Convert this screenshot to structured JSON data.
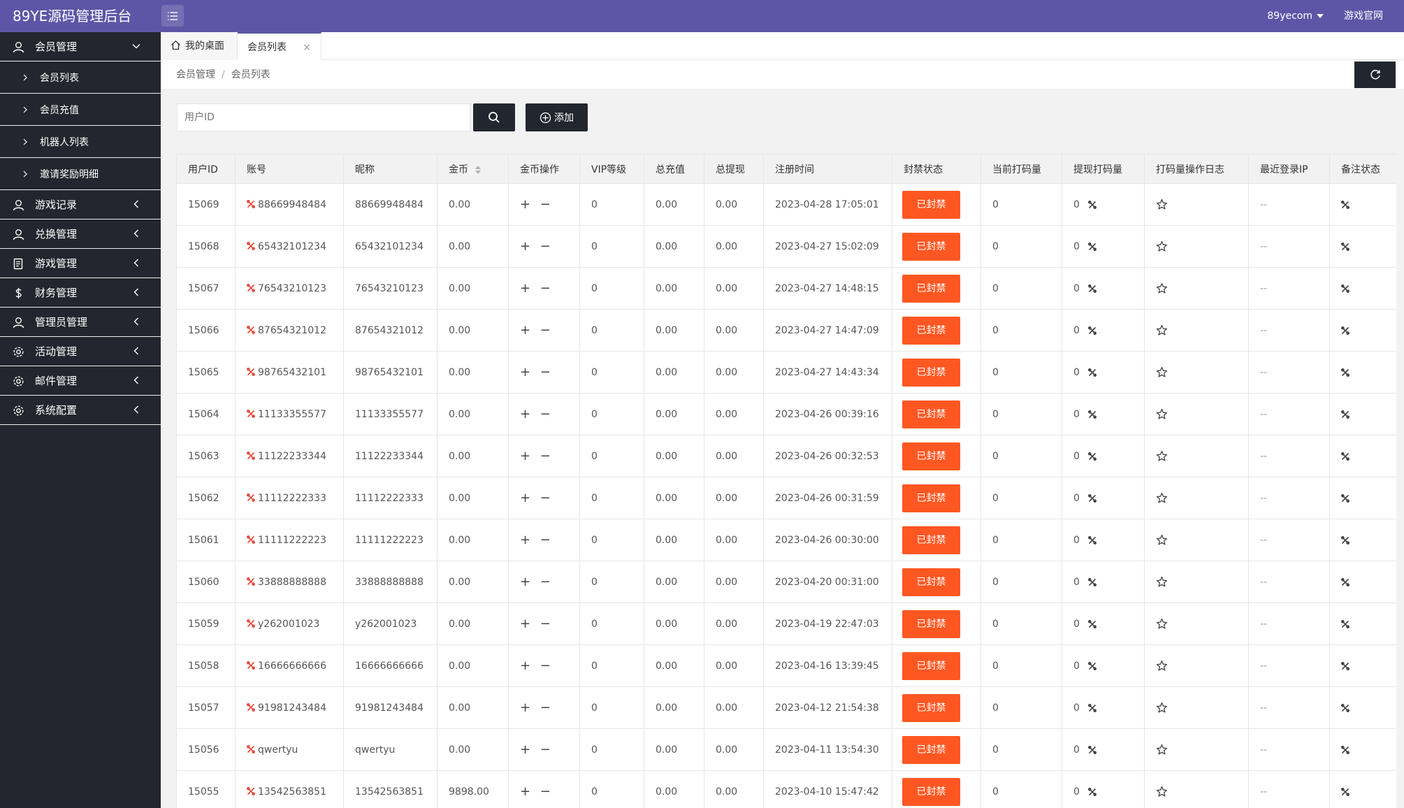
{
  "app": {
    "title": "89YE源码管理后台"
  },
  "topbar": {
    "user": "89yecom",
    "official_site": "游戏官网"
  },
  "sidebar": {
    "groups": [
      {
        "label": "会员管理",
        "icon": "user-icon",
        "expanded": true,
        "items": [
          {
            "label": "会员列表"
          },
          {
            "label": "会员充值"
          },
          {
            "label": "机器人列表"
          },
          {
            "label": "邀请奖励明细"
          }
        ]
      },
      {
        "label": "游戏记录",
        "icon": "user-icon"
      },
      {
        "label": "兑换管理",
        "icon": "user-icon"
      },
      {
        "label": "游戏管理",
        "icon": "document-icon"
      },
      {
        "label": "财务管理",
        "icon": "dollar-icon"
      },
      {
        "label": "管理员管理",
        "icon": "user-icon"
      },
      {
        "label": "活动管理",
        "icon": "gear-icon"
      },
      {
        "label": "邮件管理",
        "icon": "gear-icon"
      },
      {
        "label": "系统配置",
        "icon": "gear-icon"
      }
    ]
  },
  "tabs": [
    {
      "label": "我的桌面"
    },
    {
      "label": "会员列表",
      "close": "×"
    }
  ],
  "breadcrumb": {
    "items": [
      "会员管理",
      "会员列表"
    ],
    "separator": "/"
  },
  "search": {
    "placeholder": "用户ID",
    "add_label": "添加"
  },
  "table": {
    "headers": [
      "用户ID",
      "账号",
      "昵称",
      "金币",
      "金币操作",
      "VIP等级",
      "总充值",
      "总提现",
      "注册时间",
      "封禁状态",
      "当前打码量",
      "提现打码量",
      "打码量操作日志",
      "最近登录IP",
      "备注状态"
    ],
    "coin_op": "+ −",
    "ban_label": "已封禁",
    "empty_ip": "--",
    "rows": [
      {
        "id": "15069",
        "account": "88669948484",
        "nickname": "88669948484",
        "coins": "0.00",
        "vip": "0",
        "recharge": "0.00",
        "withdraw": "0.00",
        "reg_time": "2023-04-28 17:05:01",
        "current_bet": "0",
        "withdraw_bet": "0"
      },
      {
        "id": "15068",
        "account": "65432101234",
        "nickname": "65432101234",
        "coins": "0.00",
        "vip": "0",
        "recharge": "0.00",
        "withdraw": "0.00",
        "reg_time": "2023-04-27 15:02:09",
        "current_bet": "0",
        "withdraw_bet": "0"
      },
      {
        "id": "15067",
        "account": "76543210123",
        "nickname": "76543210123",
        "coins": "0.00",
        "vip": "0",
        "recharge": "0.00",
        "withdraw": "0.00",
        "reg_time": "2023-04-27 14:48:15",
        "current_bet": "0",
        "withdraw_bet": "0"
      },
      {
        "id": "15066",
        "account": "87654321012",
        "nickname": "87654321012",
        "coins": "0.00",
        "vip": "0",
        "recharge": "0.00",
        "withdraw": "0.00",
        "reg_time": "2023-04-27 14:47:09",
        "current_bet": "0",
        "withdraw_bet": "0"
      },
      {
        "id": "15065",
        "account": "98765432101",
        "nickname": "98765432101",
        "coins": "0.00",
        "vip": "0",
        "recharge": "0.00",
        "withdraw": "0.00",
        "reg_time": "2023-04-27 14:43:34",
        "current_bet": "0",
        "withdraw_bet": "0"
      },
      {
        "id": "15064",
        "account": "11133355577",
        "nickname": "11133355577",
        "coins": "0.00",
        "vip": "0",
        "recharge": "0.00",
        "withdraw": "0.00",
        "reg_time": "2023-04-26 00:39:16",
        "current_bet": "0",
        "withdraw_bet": "0"
      },
      {
        "id": "15063",
        "account": "11122233344",
        "nickname": "11122233344",
        "coins": "0.00",
        "vip": "0",
        "recharge": "0.00",
        "withdraw": "0.00",
        "reg_time": "2023-04-26 00:32:53",
        "current_bet": "0",
        "withdraw_bet": "0"
      },
      {
        "id": "15062",
        "account": "11112222333",
        "nickname": "11112222333",
        "coins": "0.00",
        "vip": "0",
        "recharge": "0.00",
        "withdraw": "0.00",
        "reg_time": "2023-04-26 00:31:59",
        "current_bet": "0",
        "withdraw_bet": "0"
      },
      {
        "id": "15061",
        "account": "11111222223",
        "nickname": "11111222223",
        "coins": "0.00",
        "vip": "0",
        "recharge": "0.00",
        "withdraw": "0.00",
        "reg_time": "2023-04-26 00:30:00",
        "current_bet": "0",
        "withdraw_bet": "0"
      },
      {
        "id": "15060",
        "account": "33888888888",
        "nickname": "33888888888",
        "coins": "0.00",
        "vip": "0",
        "recharge": "0.00",
        "withdraw": "0.00",
        "reg_time": "2023-04-20 00:31:00",
        "current_bet": "0",
        "withdraw_bet": "0"
      },
      {
        "id": "15059",
        "account": "y262001023",
        "nickname": "y262001023",
        "coins": "0.00",
        "vip": "0",
        "recharge": "0.00",
        "withdraw": "0.00",
        "reg_time": "2023-04-19 22:47:03",
        "current_bet": "0",
        "withdraw_bet": "0"
      },
      {
        "id": "15058",
        "account": "16666666666",
        "nickname": "16666666666",
        "coins": "0.00",
        "vip": "0",
        "recharge": "0.00",
        "withdraw": "0.00",
        "reg_time": "2023-04-16 13:39:45",
        "current_bet": "0",
        "withdraw_bet": "0"
      },
      {
        "id": "15057",
        "account": "91981243484",
        "nickname": "91981243484",
        "coins": "0.00",
        "vip": "0",
        "recharge": "0.00",
        "withdraw": "0.00",
        "reg_time": "2023-04-12 21:54:38",
        "current_bet": "0",
        "withdraw_bet": "0"
      },
      {
        "id": "15056",
        "account": "qwertyu",
        "nickname": "qwertyu",
        "coins": "0.00",
        "vip": "0",
        "recharge": "0.00",
        "withdraw": "0.00",
        "reg_time": "2023-04-11 13:54:30",
        "current_bet": "0",
        "withdraw_bet": "0"
      },
      {
        "id": "15055",
        "account": "13542563851",
        "nickname": "13542563851",
        "coins": "9898.00",
        "vip": "0",
        "recharge": "0.00",
        "withdraw": "0.00",
        "reg_time": "2023-04-10 15:47:42",
        "current_bet": "0",
        "withdraw_bet": "0"
      }
    ]
  },
  "colors": {
    "topbar": "#5d56a6",
    "sidebar": "#23262e",
    "ban": "#ff5722",
    "account_icon": "#e54b3c",
    "dark_button": "#22262e"
  }
}
